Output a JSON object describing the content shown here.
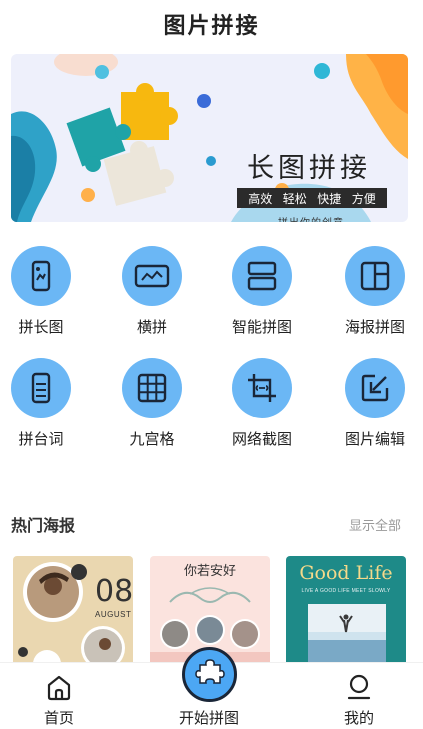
{
  "header": {
    "title": "图片拼接"
  },
  "banner": {
    "title": "长图拼接",
    "tags": [
      "高效",
      "轻松",
      "快捷",
      "方便"
    ],
    "subtitle": "拼出你的创意"
  },
  "tools": [
    {
      "label": "拼长图",
      "icon": "long-image-icon"
    },
    {
      "label": "横拼",
      "icon": "horizontal-stitch-icon"
    },
    {
      "label": "智能拼图",
      "icon": "smart-collage-icon"
    },
    {
      "label": "海报拼图",
      "icon": "poster-collage-icon"
    },
    {
      "label": "拼台词",
      "icon": "subtitle-stitch-icon"
    },
    {
      "label": "九宫格",
      "icon": "nine-grid-icon"
    },
    {
      "label": "网络截图",
      "icon": "web-screenshot-icon"
    },
    {
      "label": "图片编辑",
      "icon": "image-edit-icon"
    }
  ],
  "section": {
    "title": "热门海报",
    "more": "显示全部"
  },
  "posters": [
    {
      "number": "08",
      "month": "AUGUST"
    },
    {
      "title": "你若安好"
    },
    {
      "title": "Good Life",
      "subtitle": "LIVE A GOOD LIFE MEET SLOWLY"
    }
  ],
  "tabbar": {
    "home": "首页",
    "start": "开始拼图",
    "mine": "我的"
  },
  "colors": {
    "accent": "#6bb7f5",
    "start_button": "#4ca7f4",
    "dark": "#1a2638"
  }
}
